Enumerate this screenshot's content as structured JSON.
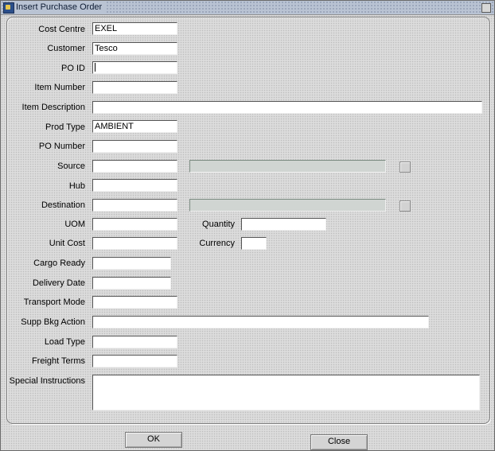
{
  "window": {
    "title": "Insert Purchase Order"
  },
  "form": {
    "cost_centre": {
      "label": "Cost Centre",
      "value": "EXEL"
    },
    "customer": {
      "label": "Customer",
      "value": "Tesco"
    },
    "po_id": {
      "label": "PO ID",
      "value": ""
    },
    "item_number": {
      "label": "Item Number",
      "value": ""
    },
    "item_description": {
      "label": "Item Description",
      "value": ""
    },
    "prod_type": {
      "label": "Prod Type",
      "value": "AMBIENT"
    },
    "po_number": {
      "label": "PO Number",
      "value": ""
    },
    "source": {
      "label": "Source",
      "value": "",
      "desc": ""
    },
    "hub": {
      "label": "Hub",
      "value": ""
    },
    "destination": {
      "label": "Destination",
      "value": "",
      "desc": ""
    },
    "uom": {
      "label": "UOM",
      "value": ""
    },
    "quantity": {
      "label": "Quantity",
      "value": ""
    },
    "unit_cost": {
      "label": "Unit Cost",
      "value": ""
    },
    "currency": {
      "label": "Currency",
      "value": ""
    },
    "cargo_ready": {
      "label": "Cargo Ready",
      "value": ""
    },
    "delivery_date": {
      "label": "Delivery Date",
      "value": ""
    },
    "transport_mode": {
      "label": "Transport Mode",
      "value": ""
    },
    "supp_bkg_action": {
      "label": "Supp Bkg Action",
      "value": ""
    },
    "load_type": {
      "label": "Load Type",
      "value": ""
    },
    "freight_terms": {
      "label": "Freight Terms",
      "value": ""
    },
    "special_instructions": {
      "label": "Special Instructions",
      "value": ""
    }
  },
  "buttons": {
    "ok": "OK",
    "close": "Close"
  }
}
